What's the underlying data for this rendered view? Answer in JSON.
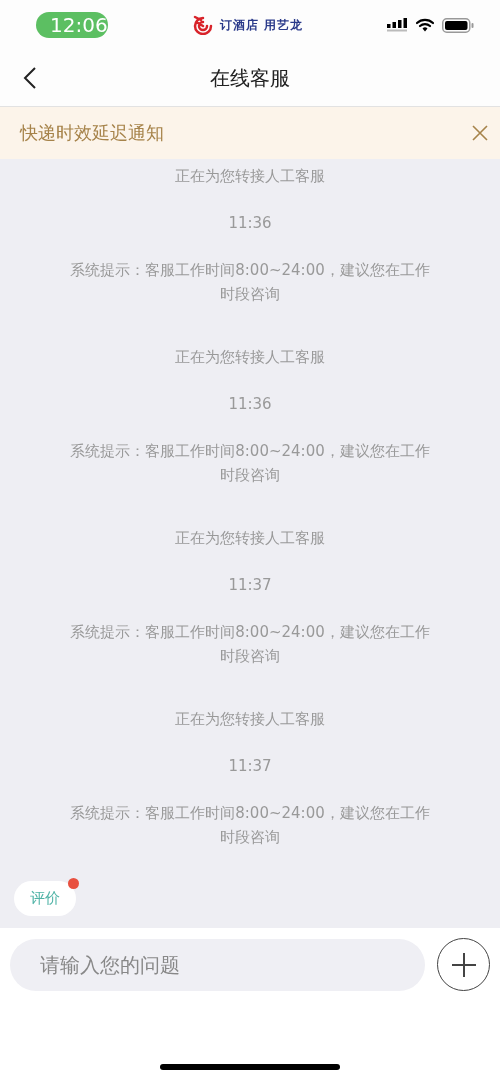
{
  "status_bar": {
    "time": "12:06",
    "banner": "订酒店 用艺龙"
  },
  "nav": {
    "title": "在线客服"
  },
  "notice": {
    "text": "快递时效延迟通知"
  },
  "messages": [
    {
      "kind": "status",
      "text": "正在为您转接人工客服"
    },
    {
      "kind": "time",
      "text": "11:36"
    },
    {
      "kind": "tip",
      "text": "系统提示：客服工作时间8:00~24:00，建议您在工作时段咨询"
    },
    {
      "kind": "status",
      "text": "正在为您转接人工客服"
    },
    {
      "kind": "time",
      "text": "11:36"
    },
    {
      "kind": "tip",
      "text": "系统提示：客服工作时间8:00~24:00，建议您在工作时段咨询"
    },
    {
      "kind": "status",
      "text": "正在为您转接人工客服"
    },
    {
      "kind": "time",
      "text": "11:37"
    },
    {
      "kind": "tip",
      "text": "系统提示：客服工作时间8:00~24:00，建议您在工作时段咨询"
    },
    {
      "kind": "status",
      "text": "正在为您转接人工客服"
    },
    {
      "kind": "time",
      "text": "11:37"
    },
    {
      "kind": "tip",
      "text": "系统提示：客服工作时间8:00~24:00，建议您在工作时段咨询"
    }
  ],
  "rating": {
    "label": "评价",
    "unread": true
  },
  "input": {
    "placeholder": "请输入您的问题"
  }
}
